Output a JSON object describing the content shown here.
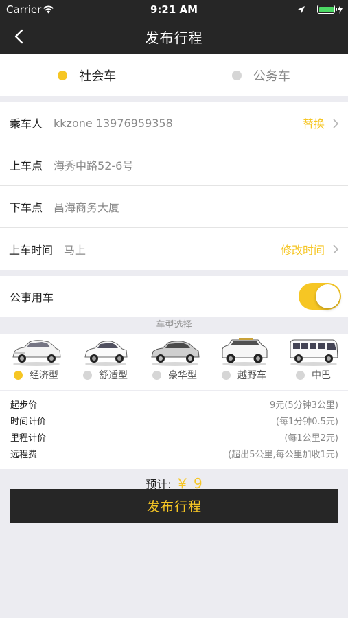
{
  "status_bar": {
    "carrier": "Carrier",
    "time": "9:21 AM",
    "battery_level": 1.0
  },
  "nav": {
    "title": "发布行程"
  },
  "segment": {
    "options": [
      "社会车",
      "公务车"
    ],
    "selected": "社会车"
  },
  "form": {
    "passenger_label": "乘车人",
    "passenger_value": "kkzone 13976959358",
    "passenger_action": "替换",
    "pickup_label": "上车点",
    "pickup_value": "海秀中路52-6号",
    "dropoff_label": "下车点",
    "dropoff_value": "昌海商务大厦",
    "time_label": "上车时间",
    "time_value": "马上",
    "time_action": "修改时间"
  },
  "official": {
    "label": "公事用车",
    "enabled": true
  },
  "car_section": {
    "title": "车型选择",
    "cars": [
      {
        "name": "经济型",
        "selected": true
      },
      {
        "name": "舒适型",
        "selected": false
      },
      {
        "name": "豪华型",
        "selected": false
      },
      {
        "name": "越野车",
        "selected": false
      },
      {
        "name": "中巴",
        "selected": false
      }
    ]
  },
  "pricing": [
    {
      "label": "起步价",
      "value": "9元(5分钟3公里)"
    },
    {
      "label": "时间计价",
      "value": "(每1分钟0.5元)"
    },
    {
      "label": "里程计价",
      "value": "(每1公里2元)"
    },
    {
      "label": "远程费",
      "value": "(超出5公里,每公里加收1元)"
    }
  ],
  "estimate": {
    "label": "预计:",
    "amount": "￥ 9"
  },
  "publish_button": "发布行程",
  "colors": {
    "accent": "#f6c624",
    "dark": "#262626",
    "background": "#ececf1"
  }
}
